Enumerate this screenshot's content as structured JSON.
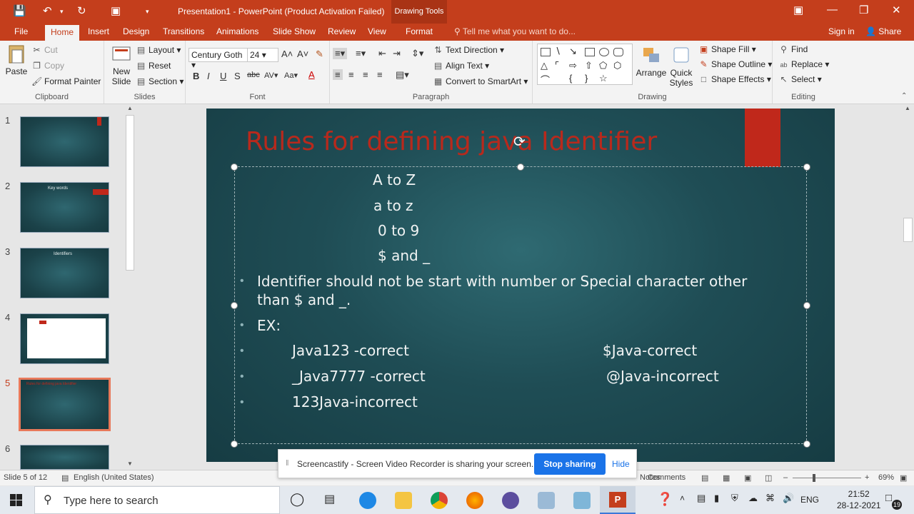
{
  "window": {
    "title": "Presentation1 - PowerPoint (Product Activation Failed)",
    "context_tab": "Drawing Tools"
  },
  "tabs": [
    "File",
    "Home",
    "Insert",
    "Design",
    "Transitions",
    "Animations",
    "Slide Show",
    "Review",
    "View",
    "Format"
  ],
  "active_tab": "Home",
  "tell_me": "Tell me what you want to do...",
  "sign_in": "Sign in",
  "share": "Share",
  "ribbon": {
    "clipboard": {
      "label": "Clipboard",
      "paste": "Paste",
      "cut": "Cut",
      "copy": "Copy",
      "format_painter": "Format Painter"
    },
    "slides": {
      "label": "Slides",
      "new_slide": "New Slide",
      "layout": "Layout",
      "reset": "Reset",
      "section": "Section"
    },
    "font": {
      "label": "Font",
      "font_name": "Century Goth",
      "font_size": "24"
    },
    "paragraph": {
      "label": "Paragraph",
      "text_direction": "Text Direction",
      "align_text": "Align Text",
      "convert_smartart": "Convert to SmartArt"
    },
    "drawing": {
      "label": "Drawing",
      "arrange": "Arrange",
      "quick_styles": "Quick Styles",
      "shape_fill": "Shape Fill",
      "shape_outline": "Shape Outline",
      "shape_effects": "Shape Effects"
    },
    "editing": {
      "label": "Editing",
      "find": "Find",
      "replace": "Replace",
      "select": "Select"
    }
  },
  "thumbnails": [
    {
      "num": "1",
      "title": ""
    },
    {
      "num": "2",
      "title": "Key words"
    },
    {
      "num": "3",
      "title": "Identifiers"
    },
    {
      "num": "4",
      "title": ""
    },
    {
      "num": "5",
      "title": "Rules for defining java Identifier"
    },
    {
      "num": "6",
      "title": ""
    }
  ],
  "slide": {
    "title": "Rules for defining java Identifier",
    "lines": [
      "A to Z",
      "a to z",
      "0 to 9",
      "$ and _",
      "Identifier should not be start with number or Special character other",
      "than $ and _.",
      "EX:",
      "Java123 -correct",
      "$Java-correct",
      "_Java7777 -correct",
      "@Java-incorrect",
      "123Java-incorrect"
    ]
  },
  "status": {
    "slide_of": "Slide 5 of 12",
    "language": "English (United States)",
    "notes": "Notes",
    "comments": "Comments",
    "zoom": "69%"
  },
  "banner": {
    "text": "Screencastify - Screen Video Recorder is sharing your screen.",
    "stop": "Stop sharing",
    "hide": "Hide"
  },
  "taskbar": {
    "search_placeholder": "Type here to search",
    "lang": "ENG",
    "time": "21:52",
    "date": "28-12-2021",
    "notifications": "19"
  },
  "colors": {
    "accent": "#c43e1c",
    "slide_bg": "#1f4d55",
    "title_red": "#b8291c"
  }
}
